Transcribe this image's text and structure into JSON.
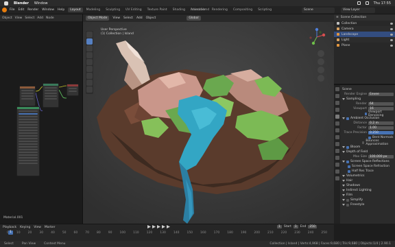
{
  "mac_menu": {
    "app": "Blender",
    "items": [
      "Window"
    ],
    "clock": "Thu 17:55"
  },
  "blender_menu": {
    "items": [
      "File",
      "Edit",
      "Render",
      "Window",
      "Help"
    ],
    "tabs": [
      "Layout",
      "Modeling",
      "Sculpting",
      "UV Editing",
      "Texture Paint",
      "Shading",
      "Animation",
      "Rendering",
      "Compositing",
      "Scripting"
    ],
    "active_tab": 0,
    "file_title": "Island.blend",
    "scene": "Scene",
    "view_layer": "View Layer"
  },
  "node_editor": {
    "header": [
      "Object",
      "View",
      "Select",
      "Add",
      "Node"
    ],
    "status": "Material.001"
  },
  "viewport": {
    "header": {
      "mode": "Object Mode",
      "menus": [
        "View",
        "Select",
        "Add",
        "Object"
      ],
      "orientation": "Global"
    },
    "info_line1": "User Perspective",
    "info_line2": "(1) Collection | Island"
  },
  "outliner": {
    "title": "Scene Collection",
    "rows": [
      {
        "label": "Collection",
        "color": "#bfbfbf"
      },
      {
        "label": "Camera",
        "color": "#d6a060"
      },
      {
        "label": "Landscape",
        "color": "#e3963e"
      },
      {
        "label": "Light",
        "color": "#d6a060"
      },
      {
        "label": "Plane",
        "color": "#e3963e"
      }
    ],
    "selected": 2
  },
  "properties": {
    "header": "Scene",
    "render_engine_label": "Render Engine",
    "render_engine": "Eevee",
    "sampling": "Sampling",
    "render_label": "Render",
    "render_value": "64",
    "viewport_label": "Viewport",
    "viewport_value": "16",
    "viewport_denoise": "Viewport Denoising",
    "ambient_occlusion": "Ambient Occlusion",
    "distance_label": "Distance",
    "distance_value": "0.2 m",
    "factor_label": "Factor",
    "factor_value": "1.00",
    "trace_label": "Trace Precision",
    "trace_value": "0.250",
    "bent_normals": "Bent Normals",
    "bounces": "Bounces Approximation",
    "bloom": "Bloom",
    "depth_of_field": "Depth of Field",
    "max_size_label": "Max Size",
    "max_size_value": "100.000 px",
    "ssr": "Screen Space Reflections",
    "refraction": "Screen Space Refraction",
    "half_res": "Half Res Trace",
    "sections": [
      "Volumetrics",
      "Hair",
      "Shadows",
      "Indirect Lighting",
      "Film",
      "Simplify",
      "Freestyle"
    ]
  },
  "timeline": {
    "menus": [
      "Playback",
      "Keying",
      "View",
      "Marker"
    ],
    "current_frame": "1",
    "start_label": "Start",
    "start": "1",
    "end_label": "End",
    "end": "250",
    "ticks": [
      "0",
      "10",
      "20",
      "30",
      "40",
      "50",
      "60",
      "70",
      "80",
      "90",
      "100",
      "110",
      "120",
      "130",
      "140",
      "150",
      "160",
      "170",
      "180",
      "190",
      "200",
      "210",
      "220",
      "230",
      "240",
      "250"
    ]
  },
  "statusbar": {
    "left": "Select",
    "mid1": "Pan View",
    "mid2": "Context Menu",
    "right": "Collection | Island | Verts:4,968 | Faces:9,680 | Tris:9,680 | Objects:1/4 | 2.90.1"
  }
}
